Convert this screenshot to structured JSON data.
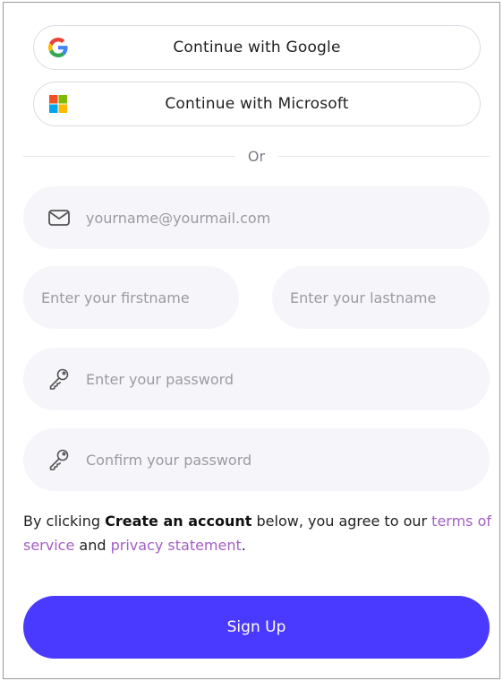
{
  "oauth": {
    "google_label": "Continue with Google",
    "microsoft_label": "Continue with Microsoft"
  },
  "divider": {
    "text": "Or"
  },
  "form": {
    "email_placeholder": "yourname@yourmail.com",
    "firstname_placeholder": "Enter your firstname",
    "lastname_placeholder": "Enter your lastname",
    "password_placeholder": "Enter your password",
    "confirm_placeholder": "Confirm your password"
  },
  "agreement": {
    "prefix": "By clicking ",
    "bold": "Create an account",
    "middle": " below, you agree to our ",
    "terms_link": "terms of service",
    "and": " and ",
    "privacy_link": "privacy statement",
    "suffix": "."
  },
  "submit": {
    "label": "Sign Up"
  },
  "colors": {
    "primary": "#4a3aff",
    "link": "#a35ec4",
    "field_bg": "#f6f6fa"
  },
  "icons": {
    "google": "google-logo-icon",
    "microsoft": "microsoft-logo-icon",
    "email": "envelope-icon",
    "password": "key-icon",
    "confirm": "key-icon"
  }
}
